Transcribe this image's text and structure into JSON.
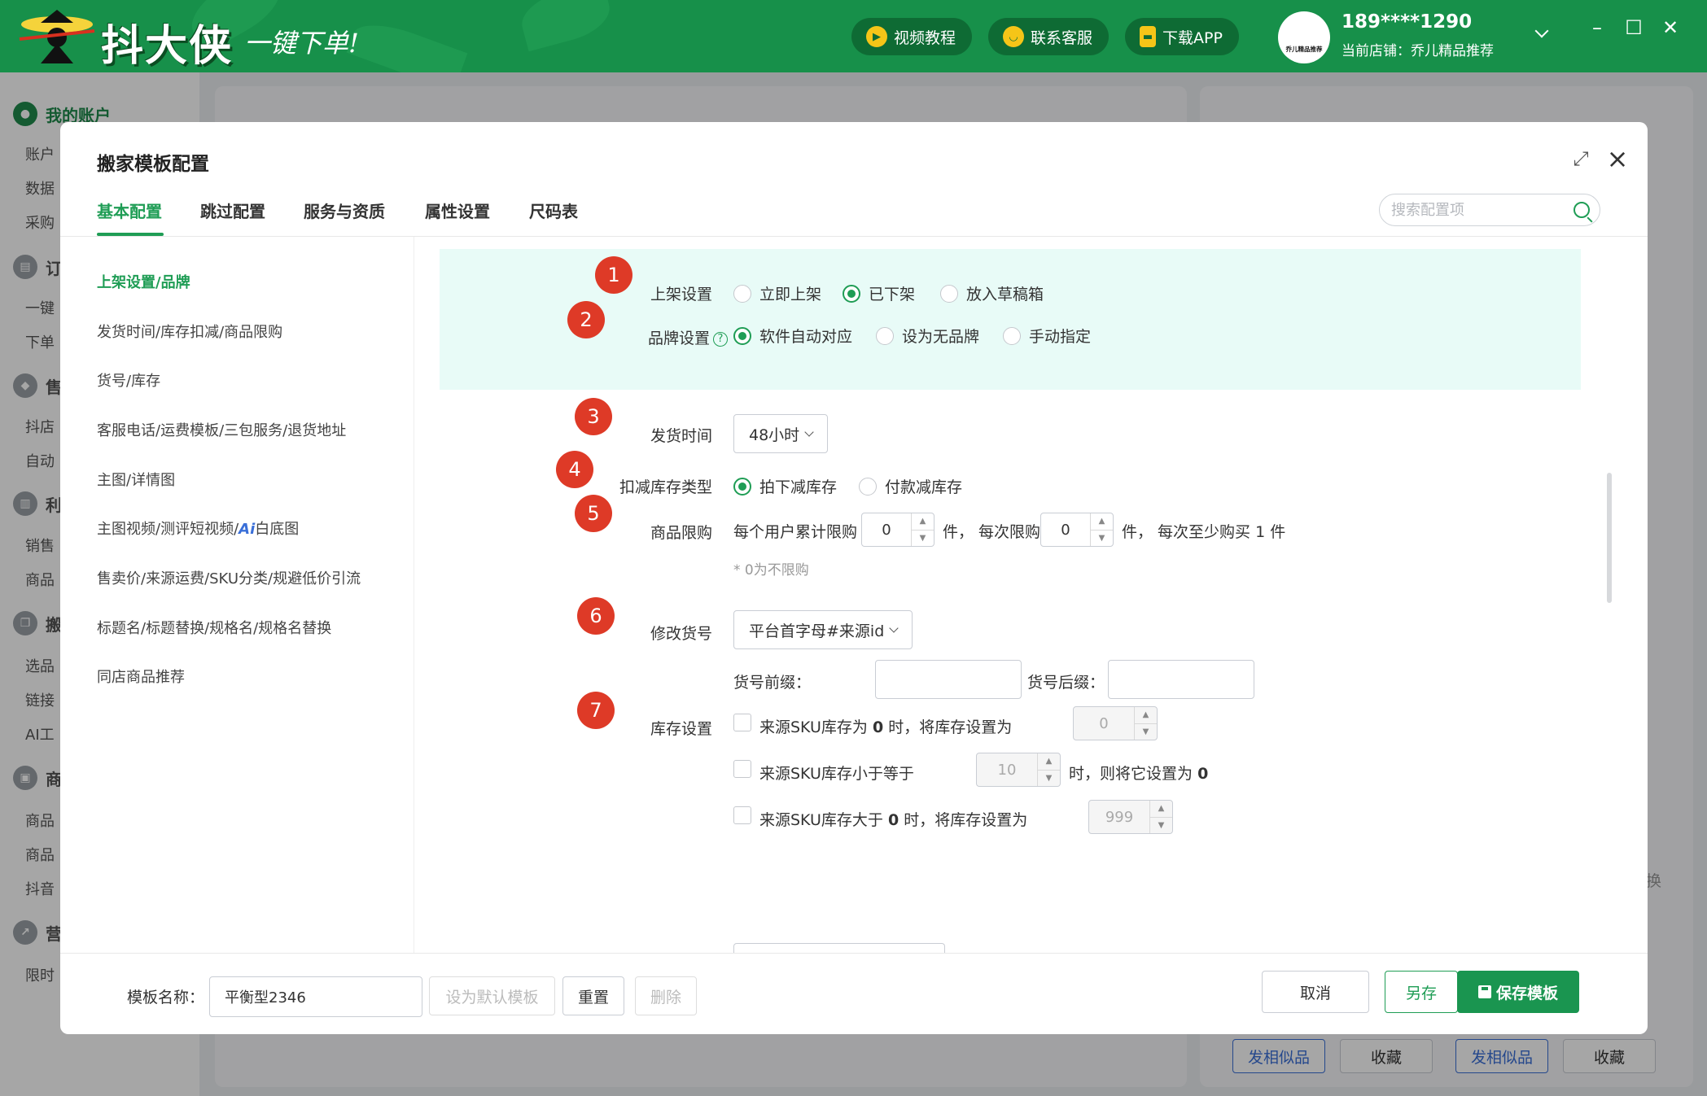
{
  "header": {
    "logo_text": "抖大侠",
    "logo_slogan": "一键下单!",
    "buttons": [
      {
        "label": "视频教程",
        "icon": "play-icon"
      },
      {
        "label": "联系客服",
        "icon": "smile-icon"
      },
      {
        "label": "下载APP",
        "icon": "phone-icon"
      }
    ],
    "account": {
      "avatar_text": "乔儿精品推荐",
      "phone": "189****1290",
      "store": "当前店铺：乔儿精品推荐"
    }
  },
  "sidebar": {
    "groups": [
      {
        "label": "我的账户",
        "items": [
          "账户",
          "数据",
          "采购"
        ]
      },
      {
        "label": "订",
        "items": [
          "一键",
          "下单"
        ]
      },
      {
        "label": "售",
        "items": [
          "抖店",
          "自动"
        ]
      },
      {
        "label": "利",
        "items": [
          "销售",
          "商品"
        ]
      },
      {
        "label": "搬",
        "items": [
          "选品",
          "链接",
          "AI工"
        ]
      },
      {
        "label": "商",
        "items": [
          "商品",
          "商品",
          "抖音"
        ]
      },
      {
        "label": "营",
        "items": [
          "限时"
        ]
      }
    ]
  },
  "background": {
    "similar_label": "发相似品",
    "collect_label": "收藏",
    "swap_text": "换"
  },
  "modal": {
    "title": "搬家模板配置",
    "tabs": [
      "基本配置",
      "跳过配置",
      "服务与资质",
      "属性设置",
      "尺码表"
    ],
    "search_placeholder": "搜索配置项",
    "nav": [
      "上架设置/品牌",
      "发货时间/库存扣减/商品限购",
      "货号/库存",
      "客服电话/运费模板/三包服务/退货地址",
      "主图/详情图",
      "主图视频/测评短视频/",
      "售卖价/来源运费/SKU分类/规避低价引流",
      "标题名/标题替换/规格名/规格名替换",
      "同店商品推荐"
    ],
    "nav_ai_prefix": "Ai",
    "nav_ai_suffix": "白底图",
    "sections": {
      "listing": {
        "num": "1",
        "label": "上架设置",
        "options": [
          "立即上架",
          "已下架",
          "放入草稿箱"
        ],
        "selected": "已下架"
      },
      "brand": {
        "num": "2",
        "label": "品牌设置",
        "help": "?",
        "options": [
          "软件自动对应",
          "设为无品牌",
          "手动指定"
        ],
        "selected": "软件自动对应"
      },
      "ship_time": {
        "num": "3",
        "label": "发货时间",
        "value": "48小时"
      },
      "stock_deduct": {
        "num": "4",
        "label": "扣减库存类型",
        "options": [
          "拍下减库存",
          "付款减库存"
        ],
        "selected": "拍下减库存"
      },
      "limit": {
        "num": "5",
        "label": "商品限购",
        "text_total": "每个用户累计限购",
        "total_value": "0",
        "text_per": "件， 每次限购",
        "per_value": "0",
        "text_tail": "件， 每次至少购买 1 件",
        "note": "* 0为不限购"
      },
      "sku_code": {
        "num": "6",
        "label": "修改货号",
        "value": "平台首字母#来源id",
        "prefix_label": "货号前缀：",
        "suffix_label": "货号后缀："
      },
      "stock": {
        "num": "7",
        "label": "库存设置",
        "rules": [
          {
            "pre": "来源SKU库存为",
            "bold": "0",
            "post": "时，将库存设置为",
            "value": "0"
          },
          {
            "pre": "来源SKU库存小于等于",
            "value": "10",
            "post": "时，则将它设置为",
            "bold": "0"
          },
          {
            "pre": "来源SKU库存大于",
            "bold": "0",
            "post": "时，将库存设置为",
            "value": "999"
          }
        ]
      }
    },
    "footer": {
      "name_label": "模板名称：",
      "name_value": "平衡型2346",
      "set_default": "设为默认模板",
      "reset": "重置",
      "delete": "删除",
      "cancel": "取消",
      "save_as": "另存",
      "save": "保存模板"
    }
  },
  "colors": {
    "brand_green": "#17904a",
    "accent": "#1f9d55",
    "marker_red": "#de3a27",
    "highlight_bg": "#e8fbf7"
  }
}
